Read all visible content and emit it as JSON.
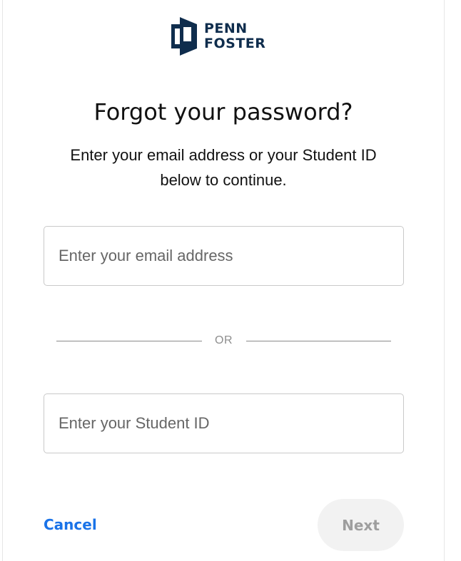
{
  "brand": {
    "logo_line1": "PENN",
    "logo_line2": "FOSTER",
    "logo_color": "#0f2d4d",
    "logo_icon": "penn-foster-logo-icon"
  },
  "heading": {
    "title": "Forgot your password?",
    "subtitle": "Enter your email address or your Student ID below to continue."
  },
  "form": {
    "email_placeholder": "Enter your email address",
    "email_value": "",
    "divider_text": "OR",
    "student_id_placeholder": "Enter your Student ID",
    "student_id_value": ""
  },
  "actions": {
    "cancel_label": "Cancel",
    "next_label": "Next",
    "next_enabled": false,
    "link_color": "#1a73e8"
  }
}
